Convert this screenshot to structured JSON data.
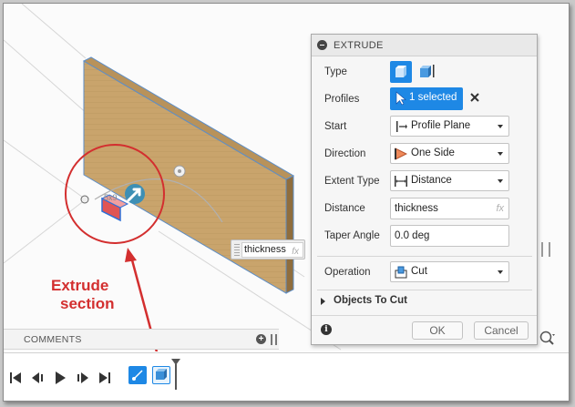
{
  "panel": {
    "title": "EXTRUDE",
    "rows": {
      "type": {
        "label": "Type",
        "icons": [
          "extrude-solid-icon",
          "extrude-surface-icon"
        ]
      },
      "profiles": {
        "label": "Profiles",
        "value": "1 selected",
        "icon": "cursor-icon",
        "clear_icon": "close-icon"
      },
      "start": {
        "label": "Start",
        "value": "Profile Plane",
        "icon": "profile-plane-icon"
      },
      "direction": {
        "label": "Direction",
        "value": "One Side",
        "icon": "one-side-icon"
      },
      "extent_type": {
        "label": "Extent Type",
        "value": "Distance",
        "icon": "distance-icon"
      },
      "distance": {
        "label": "Distance",
        "value": "thickness",
        "fx": "fx"
      },
      "taper_angle": {
        "label": "Taper Angle",
        "value": "0.0 deg"
      },
      "operation": {
        "label": "Operation",
        "value": "Cut",
        "icon": "cut-icon"
      }
    },
    "objects_to_cut": "Objects To Cut",
    "ok_label": "OK",
    "cancel_label": "Cancel",
    "info_icon": "info-icon"
  },
  "viewport": {
    "dimension_input": {
      "value": "thickness",
      "fx": "fx"
    },
    "annotation": {
      "line1": "Extrude",
      "line2": "section"
    },
    "accent_color": "#d32f2f"
  },
  "comments": {
    "label": "COMMENTS"
  },
  "timeline": {
    "controls": [
      "skip-start-icon",
      "step-back-icon",
      "play-icon",
      "step-forward-icon",
      "skip-end-icon"
    ],
    "features": [
      "sketch-feature-icon",
      "extrude-feature-icon"
    ]
  },
  "colors": {
    "selected_blue": "#1e88e5",
    "wood": "#c9a46c",
    "annotation_red": "#d32f2f"
  }
}
